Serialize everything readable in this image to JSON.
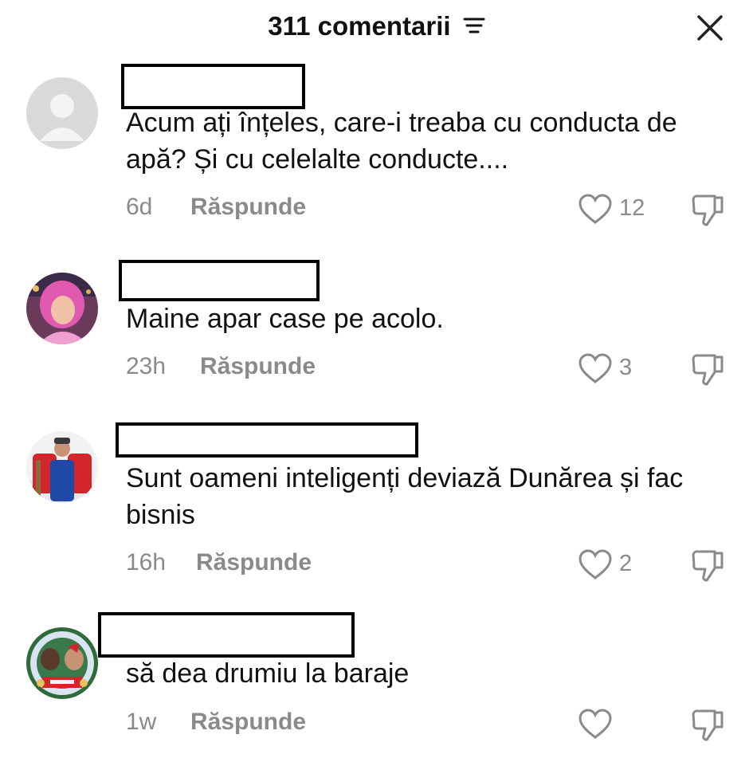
{
  "header": {
    "title": "311 comentarii"
  },
  "comments": [
    {
      "text": "Acum ați înțeles, care-i treaba cu conducta de apă? Și cu celelalte conducte....",
      "time": "6d",
      "reply": "Răspunde",
      "likes": "12"
    },
    {
      "text": "Maine apar case pe acolo.",
      "time": "23h",
      "reply": "Răspunde",
      "likes": "3"
    },
    {
      "text": "Sunt oameni inteligenți deviază Dunărea și fac bisnis",
      "time": "16h",
      "reply": "Răspunde",
      "likes": "2"
    },
    {
      "text": "să dea drumiu la baraje",
      "time": "1w",
      "reply": "Răspunde",
      "likes": ""
    }
  ],
  "colors": {
    "text": "#111111",
    "muted": "#8a8a8a",
    "background": "#ffffff"
  },
  "icons": [
    "filter-icon",
    "close-icon",
    "heart-icon",
    "dislike-icon",
    "default-avatar-icon"
  ]
}
